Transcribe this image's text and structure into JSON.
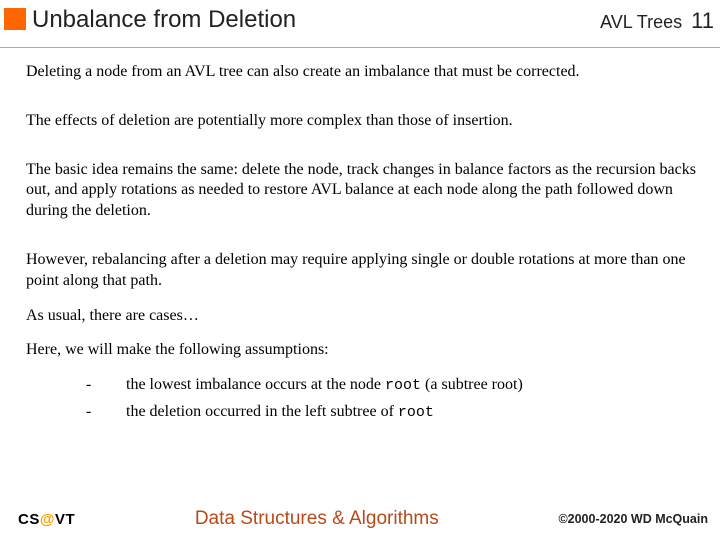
{
  "header": {
    "title": "Unbalance from Deletion",
    "course_short": "AVL Trees",
    "page_number": "11"
  },
  "body": {
    "p1": "Deleting a node from an AVL tree can also create an imbalance that must be corrected.",
    "p2": "The effects of deletion are potentially more complex than those of insertion.",
    "p3": "The basic idea remains the same:  delete the node, track changes in balance factors as the recursion backs out, and apply rotations as needed to restore AVL balance at each node along the path followed down during the deletion.",
    "p4": "However, rebalancing after a deletion may require applying single or double rotations at more than one point along that path.",
    "p5": "As usual, there are cases…",
    "p6": "Here, we will make the following assumptions:",
    "a1_pre": "the lowest imbalance occurs at the node ",
    "a1_code": "root",
    "a1_post": " (a subtree root)",
    "a2_pre": "the deletion occurred in the left subtree of ",
    "a2_code": "root",
    "dash": "-"
  },
  "footer": {
    "cs": "CS",
    "at": "@",
    "vt": "VT",
    "course": "Data Structures & Algorithms",
    "copyright": "©2000-2020 WD McQuain"
  }
}
